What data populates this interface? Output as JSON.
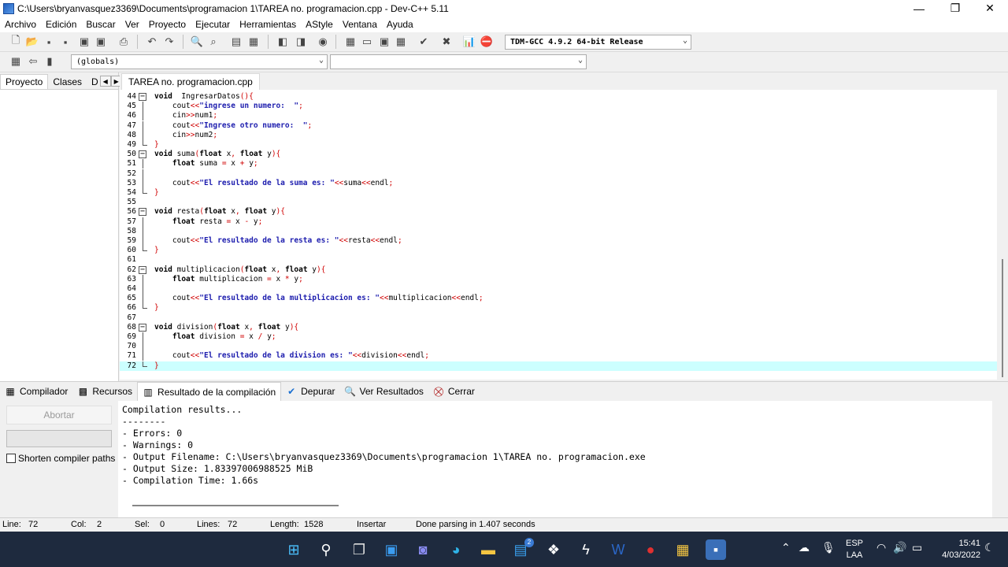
{
  "window": {
    "title": "C:\\Users\\bryanvasquez3369\\Documents\\programacion 1\\TAREA no. programacion.cpp - Dev-C++ 5.11",
    "minimize": "—",
    "maximize": "❐",
    "close": "✕"
  },
  "menu": [
    "Archivo",
    "Edición",
    "Buscar",
    "Ver",
    "Proyecto",
    "Ejecutar",
    "Herramientas",
    "AStyle",
    "Ventana",
    "Ayuda"
  ],
  "toolbar": {
    "compiler_select": "TDM-GCC 4.9.2 64-bit Release",
    "globals_select": "(globals)",
    "function_select": ""
  },
  "left_panel": {
    "tabs": [
      "Proyecto",
      "Clases",
      "D"
    ]
  },
  "editor": {
    "tab": "TAREA no. programacion.cpp",
    "lines": [
      {
        "n": "44",
        "fold": "minus",
        "code": [
          [
            "kw",
            "void"
          ],
          [
            "",
            "  IngresarDatos"
          ],
          [
            "op",
            "(){"
          ]
        ]
      },
      {
        "n": "45",
        "fold": "bar",
        "code": [
          [
            "",
            "    cout"
          ],
          [
            "op",
            "<<"
          ],
          [
            "str",
            "\"ingrese un numero:  \""
          ],
          [
            "op",
            ";"
          ]
        ]
      },
      {
        "n": "46",
        "fold": "bar",
        "code": [
          [
            "",
            "    cin"
          ],
          [
            "op",
            ">>"
          ],
          [
            "",
            "num1"
          ],
          [
            "op",
            ";"
          ]
        ]
      },
      {
        "n": "47",
        "fold": "bar",
        "code": [
          [
            "",
            "    cout"
          ],
          [
            "op",
            "<<"
          ],
          [
            "str",
            "\"Ingrese otro numero:  \""
          ],
          [
            "op",
            ";"
          ]
        ]
      },
      {
        "n": "48",
        "fold": "bar",
        "code": [
          [
            "",
            "    cin"
          ],
          [
            "op",
            ">>"
          ],
          [
            "",
            "num2"
          ],
          [
            "op",
            ";"
          ]
        ]
      },
      {
        "n": "49",
        "fold": "end",
        "code": [
          [
            "op",
            "}"
          ]
        ]
      },
      {
        "n": "50",
        "fold": "minus",
        "code": [
          [
            "kw",
            "void"
          ],
          [
            "",
            " suma"
          ],
          [
            "op",
            "("
          ],
          [
            "kw",
            "float"
          ],
          [
            "",
            " x"
          ],
          [
            "op",
            ", "
          ],
          [
            "kw",
            "float"
          ],
          [
            "",
            " y"
          ],
          [
            "op",
            "){"
          ]
        ]
      },
      {
        "n": "51",
        "fold": "bar",
        "code": [
          [
            "",
            "    "
          ],
          [
            "kw",
            "float"
          ],
          [
            "",
            " suma "
          ],
          [
            "op",
            "="
          ],
          [
            "",
            " x "
          ],
          [
            "op",
            "+"
          ],
          [
            "",
            " y"
          ],
          [
            "op",
            ";"
          ]
        ]
      },
      {
        "n": "52",
        "fold": "bar",
        "code": []
      },
      {
        "n": "53",
        "fold": "bar",
        "code": [
          [
            "",
            "    cout"
          ],
          [
            "op",
            "<<"
          ],
          [
            "str",
            "\"El resultado de la suma es: \""
          ],
          [
            "op",
            "<<"
          ],
          [
            "",
            "suma"
          ],
          [
            "op",
            "<<"
          ],
          [
            "",
            "endl"
          ],
          [
            "op",
            ";"
          ]
        ]
      },
      {
        "n": "54",
        "fold": "end",
        "code": [
          [
            "op",
            "}"
          ]
        ]
      },
      {
        "n": "55",
        "fold": "",
        "code": []
      },
      {
        "n": "56",
        "fold": "minus",
        "code": [
          [
            "kw",
            "void"
          ],
          [
            "",
            " resta"
          ],
          [
            "op",
            "("
          ],
          [
            "kw",
            "float"
          ],
          [
            "",
            " x"
          ],
          [
            "op",
            ", "
          ],
          [
            "kw",
            "float"
          ],
          [
            "",
            " y"
          ],
          [
            "op",
            "){"
          ]
        ]
      },
      {
        "n": "57",
        "fold": "bar",
        "code": [
          [
            "",
            "    "
          ],
          [
            "kw",
            "float"
          ],
          [
            "",
            " resta "
          ],
          [
            "op",
            "="
          ],
          [
            "",
            " x "
          ],
          [
            "op",
            "-"
          ],
          [
            "",
            " y"
          ],
          [
            "op",
            ";"
          ]
        ]
      },
      {
        "n": "58",
        "fold": "bar",
        "code": []
      },
      {
        "n": "59",
        "fold": "bar",
        "code": [
          [
            "",
            "    cout"
          ],
          [
            "op",
            "<<"
          ],
          [
            "str",
            "\"El resultado de la resta es: \""
          ],
          [
            "op",
            "<<"
          ],
          [
            "",
            "resta"
          ],
          [
            "op",
            "<<"
          ],
          [
            "",
            "endl"
          ],
          [
            "op",
            ";"
          ]
        ]
      },
      {
        "n": "60",
        "fold": "end",
        "code": [
          [
            "op",
            "}"
          ]
        ]
      },
      {
        "n": "61",
        "fold": "",
        "code": []
      },
      {
        "n": "62",
        "fold": "minus",
        "code": [
          [
            "kw",
            "void"
          ],
          [
            "",
            " multiplicacion"
          ],
          [
            "op",
            "("
          ],
          [
            "kw",
            "float"
          ],
          [
            "",
            " x"
          ],
          [
            "op",
            ", "
          ],
          [
            "kw",
            "float"
          ],
          [
            "",
            " y"
          ],
          [
            "op",
            "){"
          ]
        ]
      },
      {
        "n": "63",
        "fold": "bar",
        "code": [
          [
            "",
            "    "
          ],
          [
            "kw",
            "float"
          ],
          [
            "",
            " multiplicacion "
          ],
          [
            "op",
            "="
          ],
          [
            "",
            " x "
          ],
          [
            "op",
            "*"
          ],
          [
            "",
            " y"
          ],
          [
            "op",
            ";"
          ]
        ]
      },
      {
        "n": "64",
        "fold": "bar",
        "code": []
      },
      {
        "n": "65",
        "fold": "bar",
        "code": [
          [
            "",
            "    cout"
          ],
          [
            "op",
            "<<"
          ],
          [
            "str",
            "\"El resultado de la multiplicacion es: \""
          ],
          [
            "op",
            "<<"
          ],
          [
            "",
            "multiplicacion"
          ],
          [
            "op",
            "<<"
          ],
          [
            "",
            "endl"
          ],
          [
            "op",
            ";"
          ]
        ]
      },
      {
        "n": "66",
        "fold": "end",
        "code": [
          [
            "op",
            "}"
          ]
        ]
      },
      {
        "n": "67",
        "fold": "",
        "code": []
      },
      {
        "n": "68",
        "fold": "minus",
        "code": [
          [
            "kw",
            "void"
          ],
          [
            "",
            " division"
          ],
          [
            "op",
            "("
          ],
          [
            "kw",
            "float"
          ],
          [
            "",
            " x"
          ],
          [
            "op",
            ", "
          ],
          [
            "kw",
            "float"
          ],
          [
            "",
            " y"
          ],
          [
            "op",
            ")"
          ],
          [
            "op",
            "{"
          ]
        ]
      },
      {
        "n": "69",
        "fold": "bar",
        "code": [
          [
            "",
            "    "
          ],
          [
            "kw",
            "float"
          ],
          [
            "",
            " division "
          ],
          [
            "op",
            "="
          ],
          [
            "",
            " x "
          ],
          [
            "op",
            "/"
          ],
          [
            "",
            " y"
          ],
          [
            "op",
            ";"
          ]
        ]
      },
      {
        "n": "70",
        "fold": "bar",
        "code": []
      },
      {
        "n": "71",
        "fold": "bar",
        "code": [
          [
            "",
            "    cout"
          ],
          [
            "op",
            "<<"
          ],
          [
            "str",
            "\"El resultado de la division es: \""
          ],
          [
            "op",
            "<<"
          ],
          [
            "",
            "division"
          ],
          [
            "op",
            "<<"
          ],
          [
            "",
            "endl"
          ],
          [
            "op",
            ";"
          ]
        ]
      },
      {
        "n": "72",
        "fold": "end",
        "code": [
          [
            "op",
            "}"
          ]
        ]
      }
    ]
  },
  "bottom_tabs": [
    "Compilador",
    "Recursos",
    "Resultado de la compilación",
    "Depurar",
    "Ver Resultados",
    "Cerrar"
  ],
  "compile_panel": {
    "abort_button": "Abortar",
    "shorten_label": "Shorten compiler paths",
    "output": [
      "Compilation results...",
      "--------",
      "- Errors: 0",
      "- Warnings: 0",
      "- Output Filename: C:\\Users\\bryanvasquez3369\\Documents\\programacion 1\\TAREA no. programacion.exe",
      "- Output Size: 1.83397006988525 MiB",
      "- Compilation Time: 1.66s"
    ]
  },
  "status": {
    "line_label": "Line:",
    "line": "72",
    "col_label": "Col:",
    "col": "2",
    "sel_label": "Sel:",
    "sel": "0",
    "lines_label": "Lines:",
    "lines": "72",
    "length_label": "Length:",
    "length": "1528",
    "mode": "Insertar",
    "message": "Done parsing in 1.407 seconds"
  },
  "taskbar": {
    "lang_top": "ESP",
    "lang_bottom": "LAA",
    "time": "15:41",
    "date": "4/03/2022",
    "badge": "2"
  },
  "colors": {
    "keyword": "#000000",
    "string": "#1d1dae",
    "operator": "#d00000",
    "current_line": "#ccffff",
    "taskbar": "#1e2a3e"
  }
}
